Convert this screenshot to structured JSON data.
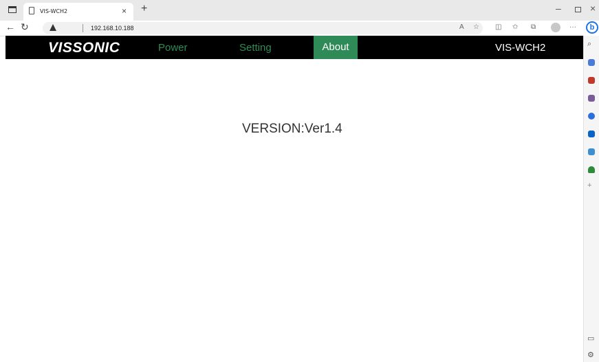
{
  "browser": {
    "tab_title": "VIS-WCH2",
    "tab_close": "×",
    "new_tab": "+",
    "min": "–",
    "close": "×",
    "url": "192.168.10.188",
    "toolbar_more": "···",
    "bing": "b"
  },
  "site": {
    "brand": "VISSONIC",
    "nav": {
      "power": "Power",
      "setting": "Setting",
      "about": "About"
    },
    "device_name": "VIS-WCH2",
    "accent_color": "#2e8b57"
  },
  "content": {
    "version": "VERSION:Ver1.4"
  }
}
